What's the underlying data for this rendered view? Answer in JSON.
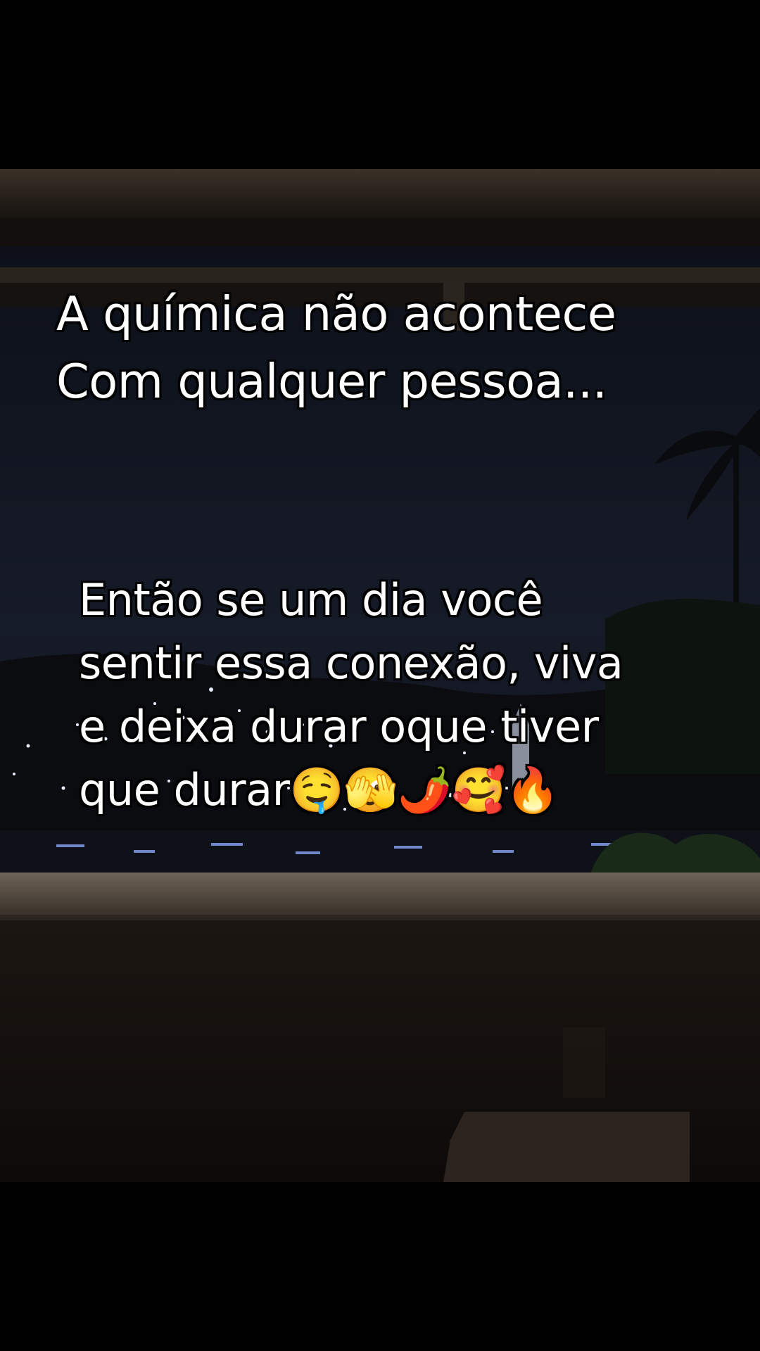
{
  "captions": {
    "top": "A química não acontece\nCom qualquer pessoa...",
    "bottom": "Então se um dia você\nsentir essa conexão, viva\ne deixa durar oque tiver\nque durar🤤🫣🌶️🥰🔥"
  }
}
